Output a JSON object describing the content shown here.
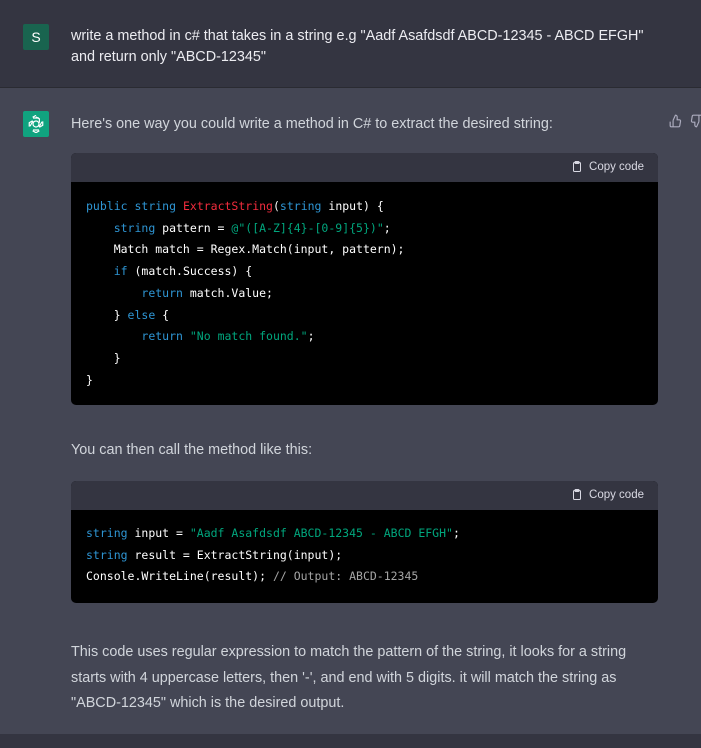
{
  "user": {
    "avatar_letter": "S",
    "message_line1": "write a method in c# that takes in a string e.g \"Aadf Asafdsdf ABCD-12345 - ABCD EFGH\"",
    "message_line2": "and return only \"ABCD-12345\""
  },
  "assistant": {
    "intro": "Here's one way you could write a method in C# to extract the desired string:",
    "copy_label": "Copy code",
    "mid_text": "You can then call the method like this:",
    "code1": [
      "public string ExtractString(string input) {",
      "    string pattern = @\"([A-Z]{4}-[0-9]{5})\";",
      "    Match match = Regex.Match(input, pattern);",
      "    if (match.Success) {",
      "        return match.Value;",
      "    } else {",
      "        return \"No match found.\";",
      "    }",
      "}"
    ],
    "code2": [
      "string input = \"Aadf Asafdsdf ABCD-12345 - ABCD EFGH\";",
      "string result = ExtractString(input);",
      "Console.WriteLine(result); // Output: ABCD-12345"
    ],
    "explanation_lines": [
      "This code uses regular expression to match the pattern of the string, it looks for a string",
      "starts with 4 uppercase letters, then '-', and end with 5 digits. it will match the string as",
      "\"ABCD-12345\" which is the desired output."
    ]
  },
  "icons": {
    "bot_avatar": "openai-logo-icon",
    "feedback": [
      "thumbs-up-icon",
      "thumbs-down-icon"
    ],
    "copy": "clipboard-icon"
  },
  "colors": {
    "page_bg": "#444654",
    "user_bg": "#343541",
    "user_avatar": "#19644f",
    "bot_avatar": "#10a37f",
    "keyword": "#2e95d3",
    "function": "#f22c3d",
    "string": "#00a67d",
    "comment": "#a5a5a5"
  }
}
